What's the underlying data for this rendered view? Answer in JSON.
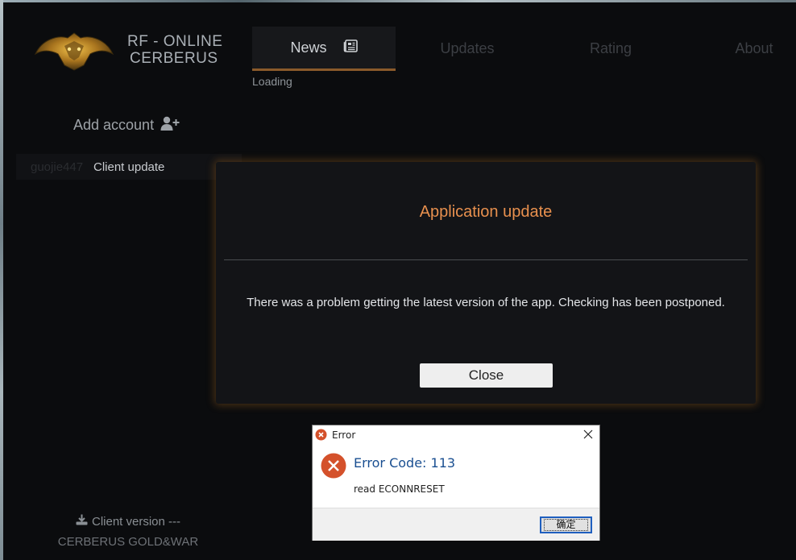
{
  "app": {
    "brand_line1": "RF - ONLINE",
    "brand_line2": "CERBERUS"
  },
  "nav": {
    "tabs": [
      {
        "label": "News",
        "active": true
      },
      {
        "label": "Updates",
        "active": false
      },
      {
        "label": "Rating",
        "active": false
      },
      {
        "label": "About",
        "active": false
      }
    ],
    "status": "Loading"
  },
  "sidebar": {
    "add_account_label": "Add account",
    "account": {
      "name": "guojie447",
      "status": "Client update"
    },
    "client_version": "Client version ---",
    "footer": "CERBERUS GOLD&WAR"
  },
  "modal": {
    "title": "Application update",
    "message": "There was a problem getting the latest version of the app. Checking has been postponed.",
    "close_label": "Close"
  },
  "error_dialog": {
    "title": "Error",
    "heading": "Error Code: 113",
    "detail": "read ECONNRESET",
    "ok_label": "确定"
  },
  "colors": {
    "accent_orange": "#e8904e",
    "tab_underline": "#8b5a2b",
    "error_red": "#d4512b",
    "error_heading": "#1a4f91"
  },
  "icons": {
    "news_tab": "newspaper-icon",
    "add_account": "user-plus-icon",
    "client_version": "download-icon",
    "error": "error-x-icon"
  }
}
